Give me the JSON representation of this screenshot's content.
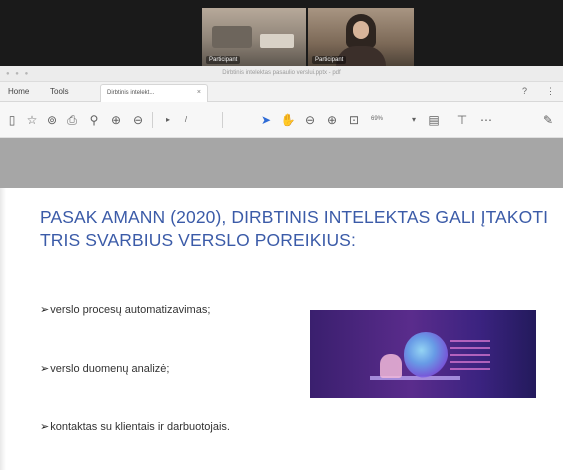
{
  "video_call": {
    "participants": [
      {
        "name": "Participant"
      },
      {
        "name": "Participant"
      }
    ]
  },
  "window": {
    "title": "Dirbtinis intelektas pasaulio verslui.pptx - pdf"
  },
  "tabs": {
    "menu": [
      "Home",
      "Tools"
    ],
    "active_tab_label": "Dirbtinis intelekt...",
    "close_glyph": "×"
  },
  "toolbar": {
    "zoom_value": "69%"
  },
  "slide": {
    "title": "PASAK AMANN (2020), DIRBTINIS INTELEKTAS GALI ĮTAKOTI TRIS SVARBIUS VERSLO POREIKIUS:",
    "bullet_marker": "➢",
    "bullets": [
      "verslo procesų automatizavimas;",
      "verslo duomenų analizė;",
      "kontaktas su klientais ir darbuotojais."
    ]
  },
  "icons": {
    "bookmark": "bookmark-icon",
    "star": "star-icon",
    "upload": "upload-icon",
    "print": "print-icon",
    "search": "search-icon",
    "page_up": "page-up-icon",
    "page_down": "page-down-icon",
    "select": "select-cursor-icon",
    "hand": "hand-tool-icon",
    "zoom_out": "zoom-out-icon",
    "zoom_in": "zoom-in-icon",
    "fit": "fit-page-icon",
    "comment": "comment-icon",
    "more": "more-icon",
    "sign": "sign-icon",
    "help": "help-icon",
    "account": "account-icon"
  },
  "colors": {
    "title_blue": "#3b5ba8",
    "header_gray": "#a6a6a6",
    "image_purple": "#5a2c8c"
  }
}
